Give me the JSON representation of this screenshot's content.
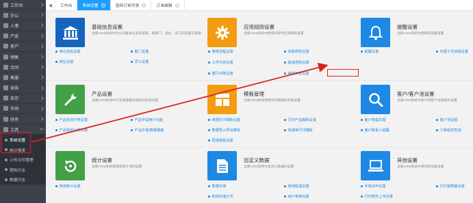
{
  "sidebar": {
    "items": [
      {
        "label": "工作台"
      },
      {
        "label": "办公"
      },
      {
        "label": "人事"
      },
      {
        "label": "产品"
      },
      {
        "label": "客户"
      },
      {
        "label": "销售"
      },
      {
        "label": "合同"
      },
      {
        "label": "售服"
      },
      {
        "label": "采购"
      },
      {
        "label": "库存"
      },
      {
        "label": "市场"
      },
      {
        "label": "财务"
      },
      {
        "label": "工具"
      }
    ],
    "sub_items": [
      {
        "label": "系统设置"
      },
      {
        "label": "统计报表"
      },
      {
        "label": "上传文件管理"
      },
      {
        "label": "登陆日志"
      },
      {
        "label": "数据日志"
      }
    ]
  },
  "tabbar": {
    "nav_prev": "◀",
    "tabs": [
      {
        "label": "工作台"
      },
      {
        "label": "系统设置"
      },
      {
        "label": "普网订单列表"
      },
      {
        "label": "订单编辑"
      }
    ]
  },
  "cards": [
    {
      "title": "基础信息设置",
      "desc": "全部CRM系统中对公司基本信息的设置，如部门、岗位、员工的设置与管理",
      "color": "#1565c0",
      "icon": "bank-icon",
      "links": [
        "单位信息设置",
        "部门设置",
        "岗位设置",
        "员工设置"
      ]
    },
    {
      "title": "应用规则设置",
      "desc": "全部CRM系统中使用的软件应用规则设置",
      "color": "#f39c12",
      "icon": "gear-icon",
      "links": [
        "审核流程设置",
        "考勤规则设置",
        "工作计划设置",
        "提成规则设置",
        "银行对账设置",
        "审核目标设置"
      ]
    },
    {
      "title": "提醒设置",
      "desc": "全部CRM系统中使用的提醒设置",
      "color": "#1e88e5",
      "icon": "bell-icon",
      "links": [
        "提醒设置",
        "日报工作流程设置"
      ]
    },
    {
      "title": "产品设置",
      "desc": "全部CRM系统中产品管理模块相关的系统设置",
      "color": "#43a047",
      "icon": "wrench-icon",
      "links": [
        "产品自动分类设置",
        "产品字段用户功能",
        "产品规划分类设置",
        "产品价格/数量精度"
      ]
    },
    {
      "title": "模板管理",
      "desc": "全部CRM系统使用到的模板的管理设置",
      "color": "#f39c12",
      "icon": "template-icon",
      "links": [
        "单据打印模板设置",
        "打印产品模板设置",
        "数据导入导出模板",
        "快递单打印模板",
        "短信模板设置"
      ]
    },
    {
      "title": "客户/客户池设置",
      "desc": "全部CRM系统中客户和客户池相关的设置",
      "color": "#1e88e5",
      "icon": "search-icon",
      "links": [
        "客户档案设置",
        "客户池设置",
        "客户联系人提醒",
        "工商信息查询"
      ]
    },
    {
      "title": "统计设置",
      "desc": "全部CRM系统使用到统计项的设置",
      "color": "#43a047",
      "icon": "refresh-icon",
      "links": [
        "常用统计设置"
      ]
    },
    {
      "title": "自定义数据",
      "desc": "全部CRM系统中自定义数据的设置",
      "color": "#1e88e5",
      "icon": "document-icon",
      "links": [
        "数据字典",
        "常用短语设置",
        "物流快递方式",
        "用户单单设置"
      ]
    },
    {
      "title": "其他设置",
      "desc": "全部CRM系统中用到的功能设置",
      "color": "#1e88e5",
      "icon": "laptop-icon",
      "links": [
        "手机APP设置",
        "打印报表格设置",
        "打印部件上传设置"
      ]
    }
  ]
}
